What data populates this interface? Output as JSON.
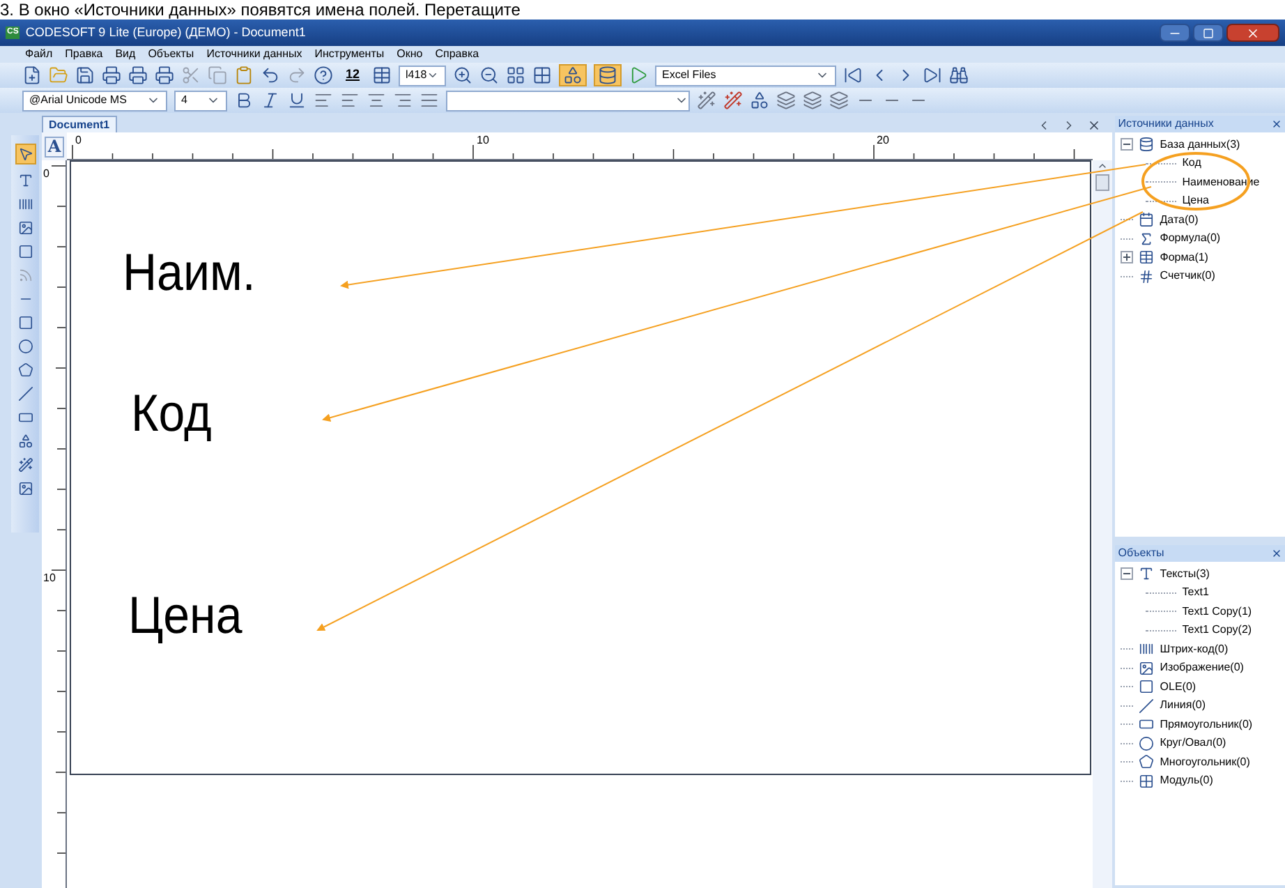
{
  "caption": "3. В окно «Источники данных» появятся имена полей. Перетащите",
  "window": {
    "title": "CODESOFT 9 Lite (Europe) (ДЕМО) - Document1",
    "app_icon": "CS"
  },
  "menu": [
    "Файл",
    "Правка",
    "Вид",
    "Объекты",
    "Источники данных",
    "Инструменты",
    "Окно",
    "Справка"
  ],
  "toolbar1": {
    "font_size_button": "12",
    "zoom_field": "l418",
    "data_source_field": "Excel Files"
  },
  "toolbar2": {
    "font_field": "@Arial Unicode MS",
    "size_field": "4"
  },
  "text_mode_button": "A",
  "tabs": [
    {
      "label": "Document1",
      "selected": true
    }
  ],
  "ruler": {
    "horizontal": [
      "0",
      "10",
      "20"
    ],
    "vertical": [
      "0",
      "10"
    ]
  },
  "canvas": {
    "texts": [
      "Наим.",
      "Код",
      "Цена"
    ]
  },
  "data_sources": {
    "title": "Источники данных",
    "items": [
      {
        "label": "База данных(3)",
        "expanded": true,
        "children": [
          {
            "label": "Код"
          },
          {
            "label": "Наименование"
          },
          {
            "label": "Цена"
          }
        ]
      },
      {
        "label": "Дата(0)"
      },
      {
        "label": "Формула(0)"
      },
      {
        "label": "Форма(1)",
        "expanded": false
      },
      {
        "label": "Счетчик(0)"
      }
    ]
  },
  "objects": {
    "title": "Объекты",
    "items": [
      {
        "label": "Тексты(3)",
        "expanded": true,
        "children": [
          {
            "label": "Text1"
          },
          {
            "label": "Text1 Copy(1)"
          },
          {
            "label": "Text1 Copy(2)"
          }
        ]
      },
      {
        "label": "Штрих-код(0)"
      },
      {
        "label": "Изображение(0)"
      },
      {
        "label": "OLE(0)"
      },
      {
        "label": "Линия(0)"
      },
      {
        "label": "Прямоугольник(0)"
      },
      {
        "label": "Круг/Овал(0)"
      },
      {
        "label": "Многоугольник(0)"
      },
      {
        "label": "Модуль(0)"
      }
    ]
  }
}
